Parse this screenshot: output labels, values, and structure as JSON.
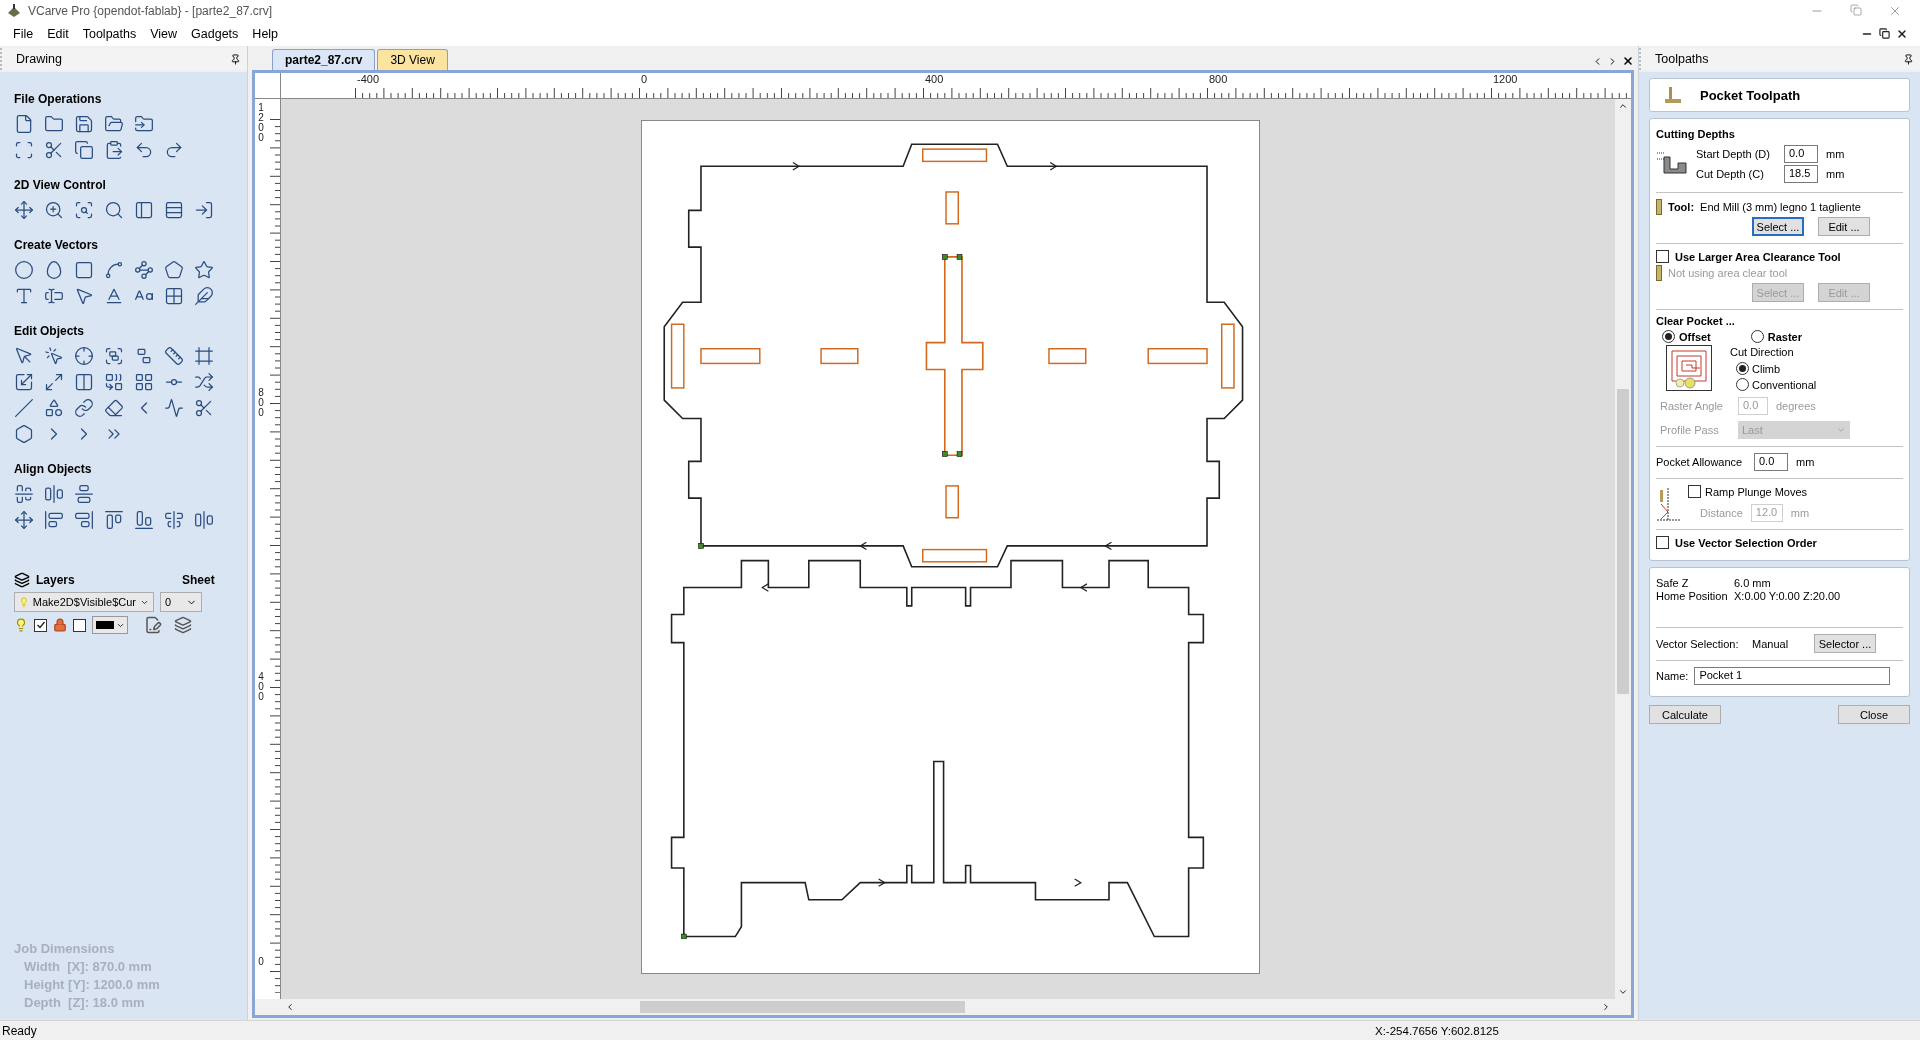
{
  "window": {
    "title": "VCarve Pro {opendot-fablab} - [parte2_87.crv]"
  },
  "menu": [
    "File",
    "Edit",
    "Toolpaths",
    "View",
    "Gadgets",
    "Help"
  ],
  "left_panel": {
    "title": "Drawing",
    "sections": [
      {
        "title": "File Operations"
      },
      {
        "title": "2D View Control"
      },
      {
        "title": "Create Vectors"
      },
      {
        "title": "Edit Objects"
      },
      {
        "title": "Align Objects"
      }
    ],
    "layers": {
      "title": "Layers",
      "layer": "Make2D$Visible$Cur",
      "sheet_title": "Sheet",
      "sheet": "0",
      "visible": true,
      "locked": false
    },
    "job_dimensions": {
      "title": "Job Dimensions",
      "lines": [
        "Width  [X]: 870.0 mm",
        "Height [Y]: 1200.0 mm",
        "Depth  [Z]: 18.0 mm"
      ]
    }
  },
  "document_tabs": [
    {
      "label": "parte2_87.crv",
      "selected": true
    },
    {
      "label": "3D View",
      "selected": false
    }
  ],
  "rulers": {
    "x_labels": [
      "-400",
      "0",
      "400",
      "800",
      "1200"
    ],
    "y_labels": [
      "1200",
      "800",
      "400",
      "0"
    ]
  },
  "toolpaths_panel": {
    "title": "Toolpaths",
    "header": "Pocket Toolpath",
    "cutting_depths": {
      "title": "Cutting Depths",
      "fields": [
        {
          "label": "Start Depth (D)",
          "value": "0.0",
          "unit": "mm"
        },
        {
          "label": "Cut Depth (C)",
          "value": "18.5",
          "unit": "mm"
        }
      ]
    },
    "tool": {
      "label": "Tool:",
      "name": "End Mill (3 mm) legno 1 tagliente",
      "buttons": [
        {
          "label": "Select ...",
          "focused": true
        },
        {
          "label": "Edit ...",
          "focused": false
        }
      ]
    },
    "area_clearance": {
      "label": "Use Larger Area Clearance Tool",
      "checked": false,
      "note": "Not using area clear tool",
      "buttons": [
        {
          "label": "Select ..."
        },
        {
          "label": "Edit ..."
        }
      ]
    },
    "clear_pocket": {
      "title": "Clear Pocket ...",
      "strategies": [
        {
          "label": "Offset",
          "selected": true
        },
        {
          "label": "Raster",
          "selected": false
        }
      ],
      "cut_direction_title": "Cut Direction",
      "directions": [
        {
          "label": "Climb",
          "selected": true
        },
        {
          "label": "Conventional",
          "selected": false
        }
      ],
      "raster_angle": {
        "label": "Raster Angle",
        "value": "0.0",
        "unit": "degrees"
      },
      "profile_pass": {
        "label": "Profile Pass",
        "value": "Last"
      }
    },
    "pocket_allowance": {
      "label": "Pocket Allowance",
      "value": "0.0",
      "unit": "mm"
    },
    "ramp": {
      "label": "Ramp Plunge Moves",
      "checked": false,
      "distance_label": "Distance",
      "distance_value": "12.0",
      "unit": "mm"
    },
    "vector_order": {
      "label": "Use Vector Selection Order",
      "checked": false
    },
    "info": [
      {
        "label": "Safe Z",
        "value": "6.0 mm"
      },
      {
        "label": "Home Position",
        "value": "X:0.00 Y:0.00 Z:20.00"
      }
    ],
    "vector_selection": {
      "label": "Vector Selection:",
      "value": "Manual",
      "button": "Selector ..."
    },
    "name": {
      "label": "Name:",
      "value": "Pocket 1"
    },
    "buttons": [
      "Calculate",
      "Close"
    ]
  },
  "status_bar": {
    "text": "Ready",
    "coordinates": "X:-254.7656 Y:602.8125"
  }
}
